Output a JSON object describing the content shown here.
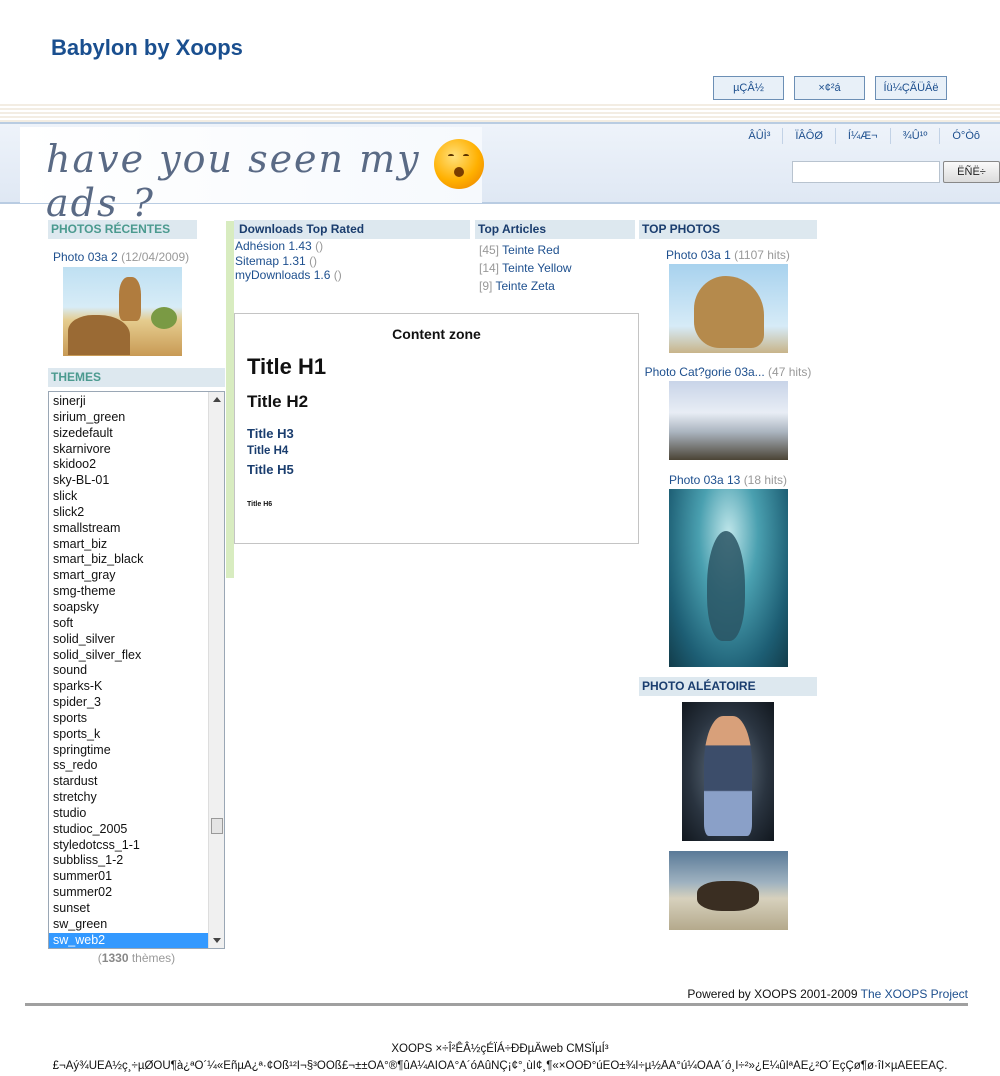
{
  "header": {
    "site_title": "Babylon by Xoops",
    "buttons": [
      "µÇÂ½",
      "×¢²á",
      "Íü¼ÇÃÜÂë"
    ]
  },
  "banner": {
    "slogan": "have you seen my ads ?",
    "nav": [
      "ÂÛÌ³",
      "ÏÂÔØ",
      "Í¼Æ¬",
      "¾Û¹º",
      "Ó°Òô"
    ],
    "search_value": "",
    "search_button": "ËÑË÷"
  },
  "left": {
    "photos_recentes_title": "PHOTOS RÉCENTES",
    "recent_photo": {
      "title": "Photo 03a 2",
      "date": "(12/04/2009)"
    },
    "themes_title": "THEMES",
    "themes": [
      "sinerji",
      "sirium_green",
      "sizedefault",
      "skarnivore",
      "skidoo2",
      "sky-BL-01",
      "slick",
      "slick2",
      "smallstream",
      "smart_biz",
      "smart_biz_black",
      "smart_gray",
      "smg-theme",
      "soapsky",
      "soft",
      "solid_silver",
      "solid_silver_flex",
      "sound",
      "sparks-K",
      "spider_3",
      "sports",
      "sports_k",
      "springtime",
      "ss_redo",
      "stardust",
      "stretchy",
      "studio",
      "studioc_2005",
      "styledotcss_1-1",
      "subbliss_1-2",
      "summer01",
      "summer02",
      "sunset",
      "sw_green",
      "sw_web2"
    ],
    "selected_theme": "sw_web2",
    "theme_count": "1330",
    "theme_count_suffix": " thèmes)",
    "theme_count_prefix": "("
  },
  "downloads": {
    "title": "Downloads Top Rated",
    "items": [
      {
        "name": "Adhésion 1.43",
        "extra": "()"
      },
      {
        "name": "Sitemap 1.31",
        "extra": "()"
      },
      {
        "name": "myDownloads 1.6",
        "extra": "()"
      }
    ]
  },
  "top_articles": {
    "title": "Top Articles",
    "items": [
      {
        "count": "[45]",
        "name": "Teinte Red"
      },
      {
        "count": "[14]",
        "name": "Teinte Yellow"
      },
      {
        "count": "[9]",
        "name": "Teinte Zeta"
      }
    ]
  },
  "content_zone": {
    "title": "Content zone",
    "h1": "Title H1",
    "h2": "Title H2",
    "h3": "Title H3",
    "h4": "Title H4",
    "h5": "Title H5",
    "h6": "Title H6"
  },
  "top_photos": {
    "title": "TOP PHOTOS",
    "items": [
      {
        "name": "Photo 03a 1",
        "hits": "(1107 hits)"
      },
      {
        "name": "Photo Cat?gorie 03a...",
        "hits": "(47 hits)"
      },
      {
        "name": "Photo 03a 13",
        "hits": "(18 hits)"
      }
    ]
  },
  "photo_aleatoire": {
    "title": "PHOTO ALÉATOIRE"
  },
  "footer": {
    "powered_prefix": "Powered by XOOPS 2001-2009 ",
    "powered_link": "The XOOPS Project",
    "line1": "XOOPS ×÷Î²ÊÂ½çÉÏÁ÷ÐÐµÄweb CMSÏµÍ³",
    "line2": "£¬Äý¾ÛÊÀ½ç¸÷µØÖÚ¶à¿ªÔ´¼«ÉñµÄ¿ª·¢Õß¹²Í¬§³ÕÕß£¬±±ÖÁ°®¶ûÀ¼ÄÏÖÁ°Ä´óÀûÑÇ¡¢°¸ùÎ¢¸¶«×ÕÖÐ°úÈÕ±¾Ï÷µ½ÅÃ°ú¼ÓÄÃ´ó¸Î÷²»¿É¼ûÎªÄÊ¿²Ô´ÉçÇø¶ø·îÏ×µÄÈËÈÃÇ."
  }
}
